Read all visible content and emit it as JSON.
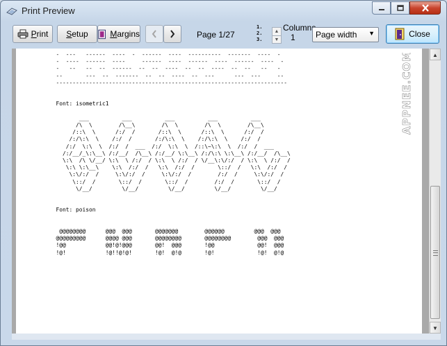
{
  "window": {
    "title": "Print Preview",
    "icon": "printer-preview-icon"
  },
  "toolbar": {
    "print_label": "Print",
    "print_underline": "P",
    "setup_label": "Setup",
    "setup_underline": "S",
    "margins_label": "Margins",
    "margins_underline": "M",
    "page_label": "Page 1/27",
    "columns_label": "Columns",
    "columns_value": "1",
    "columns_icon_text": "1.\n2.\n3.",
    "zoom_selected": "Page width",
    "close_label": "Close",
    "close_underline": "C"
  },
  "preview": {
    "content": "  -  ---   ------  ----  -  ------  ----  ----------  -------  ----  -\n  -  ----  ------  ----     ------  ----  ------  ----  ------  ----  -\n  -   --   --  --  ------  --  --  ----  --  --  ----  --  --   --   -\n  --       ---  --  -------  --  --  ----  --  ---      ---  ---     --\n  ----------------------------------------------------------------------\n\n\n  Font: isometric1\n\n         ___          ___          ___          ___          ___\n        /\\  \\        /\\__\\        /\\  \\        /\\  \\        /\\__\\\n       /::\\  \\      /:/  /       /::\\  \\      /::\\  \\      /:/  /\n      /:/\\:\\  \\    /:/  /       /:/\\:\\  \\    /:/\\:\\  \\    /:/  /\n     /:/  \\:\\  \\  /:/  /  ___  /:/  \\:\\  \\  /::\\~\\:\\  \\  /:/  /  ___\n    /:/__/_\\:\\__\\ /:/__/  /\\__\\ /:/__/ \\:\\__\\ /:/\\:\\ \\:\\__\\ /:/__/  /\\__\\\n    \\:\\  /\\ \\/__/ \\:\\  \\ /:/  / \\:\\  \\ /:/  / \\/__\\:\\/:/  / \\:\\  \\ /:/  /\n     \\:\\ \\:\\__\\    \\:\\  /:/  /   \\:\\  /:/  /       \\::/  /   \\:\\  /:/  /\n      \\:\\/:/  /     \\:\\/:/  /     \\:\\/:/  /        /:/  /     \\:\\/:/  /\n       \\::/  /       \\::/  /       \\::/  /        /:/  /       \\::/  /\n        \\/__/         \\/__/         \\/__/         \\/__/         \\/__/\n\n\n  Font: poison\n\n\n   @@@@@@@@      @@@  @@@       @@@@@@@        @@@@@@         @@@  @@@\n  @@@@@@@@@      @@@@ @@@       @@@@@@@@       @@@@@@@@        @@@  @@@\n  !@@            @@!@!@@@       @@!  @@@       !@@             @@!  @@@\n  !@!            !@!!@!@!       !@!  @!@       !@!             !@!  @!@"
  },
  "watermark": "APPNEE.COM"
}
